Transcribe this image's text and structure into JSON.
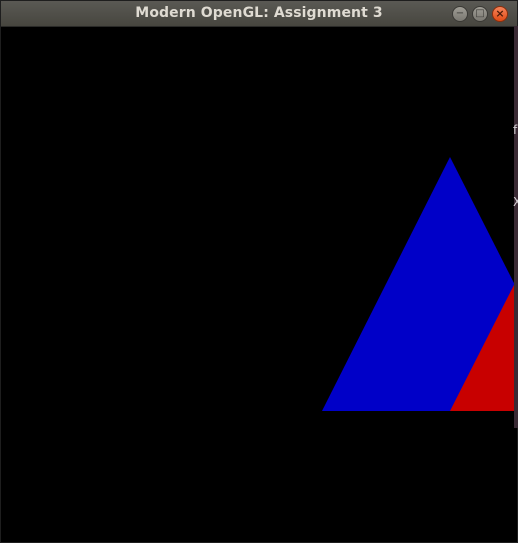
{
  "window": {
    "title": "Modern OpenGL: Assignment 3",
    "controls": {
      "minimize_glyph": "−",
      "maximize_glyph": "□",
      "close_glyph": "×"
    }
  },
  "scene": {
    "background_color": "#000000",
    "shapes": [
      {
        "name": "blue-triangle",
        "color": "#0000c8"
      },
      {
        "name": "red-triangle",
        "color": "#c80000"
      }
    ]
  },
  "background_edge": {
    "glyphs": [
      "f",
      "X"
    ]
  }
}
